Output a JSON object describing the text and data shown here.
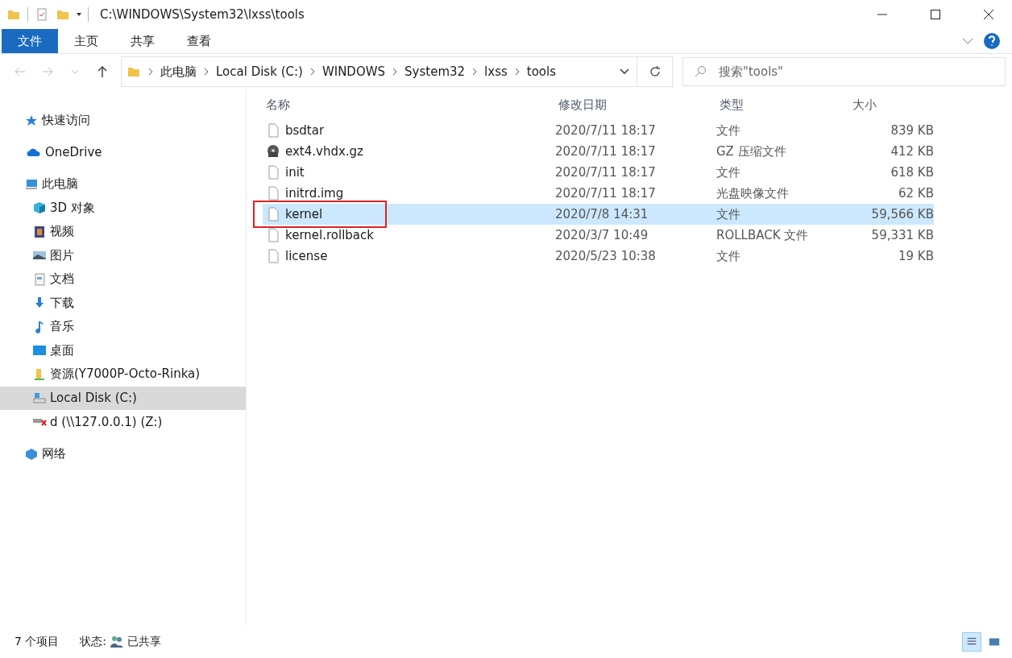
{
  "window": {
    "title": "C:\\WINDOWS\\System32\\lxss\\tools"
  },
  "ribbon_tabs": [
    {
      "label": "文件",
      "selected": true
    },
    {
      "label": "主页",
      "selected": false
    },
    {
      "label": "共享",
      "selected": false
    },
    {
      "label": "查看",
      "selected": false
    }
  ],
  "breadcrumb": [
    "此电脑",
    "Local Disk (C:)",
    "WINDOWS",
    "System32",
    "lxss",
    "tools"
  ],
  "search": {
    "placeholder": "搜索\"tools\""
  },
  "sidebar": {
    "items": [
      {
        "label": "快速访问",
        "kind": "star",
        "selected": false
      },
      {
        "label": "OneDrive",
        "kind": "cloud",
        "selected": false
      },
      {
        "label": "此电脑",
        "kind": "pc",
        "selected": false,
        "children": [
          {
            "label": "3D 对象",
            "kind": "cube",
            "selected": false
          },
          {
            "label": "视频",
            "kind": "video",
            "selected": false
          },
          {
            "label": "图片",
            "kind": "picture",
            "selected": false
          },
          {
            "label": "文档",
            "kind": "document",
            "selected": false
          },
          {
            "label": "下载",
            "kind": "download",
            "selected": false
          },
          {
            "label": "音乐",
            "kind": "music",
            "selected": false
          },
          {
            "label": "桌面",
            "kind": "desktop",
            "selected": false
          },
          {
            "label": "资源(Y7000P-Octo-Rinka)",
            "kind": "share",
            "selected": false
          },
          {
            "label": "Local Disk (C:)",
            "kind": "disk",
            "selected": true
          },
          {
            "label": "d (\\\\127.0.0.1) (Z:)",
            "kind": "netdrive",
            "selected": false
          }
        ]
      },
      {
        "label": "网络",
        "kind": "network",
        "selected": false
      }
    ]
  },
  "table": {
    "columns": [
      "名称",
      "修改日期",
      "类型",
      "大小"
    ],
    "rows": [
      {
        "name": "bsdtar",
        "kind": "file",
        "date": "2020/7/11 18:17",
        "type": "文件",
        "size": "839 KB",
        "selected": false,
        "annotated": false
      },
      {
        "name": "ext4.vhdx.gz",
        "kind": "archive",
        "date": "2020/7/11 18:17",
        "type": "GZ 压缩文件",
        "size": "412 KB",
        "selected": false,
        "annotated": false
      },
      {
        "name": "init",
        "kind": "file",
        "date": "2020/7/11 18:17",
        "type": "文件",
        "size": "618 KB",
        "selected": false,
        "annotated": false
      },
      {
        "name": "initrd.img",
        "kind": "file",
        "date": "2020/7/11 18:17",
        "type": "光盘映像文件",
        "size": "62 KB",
        "selected": false,
        "annotated": false
      },
      {
        "name": "kernel",
        "kind": "file",
        "date": "2020/7/8 14:31",
        "type": "文件",
        "size": "59,566 KB",
        "selected": true,
        "annotated": true
      },
      {
        "name": "kernel.rollback",
        "kind": "file",
        "date": "2020/3/7 10:49",
        "type": "ROLLBACK 文件",
        "size": "59,331 KB",
        "selected": false,
        "annotated": false
      },
      {
        "name": "license",
        "kind": "file",
        "date": "2020/5/23 10:38",
        "type": "文件",
        "size": "19 KB",
        "selected": false,
        "annotated": false
      }
    ]
  },
  "status_bar": {
    "count": "7 个项目",
    "state_label": "状态:",
    "state": "已共享",
    "views": [
      {
        "kind": "details",
        "selected": true
      },
      {
        "kind": "large",
        "selected": false
      }
    ]
  }
}
